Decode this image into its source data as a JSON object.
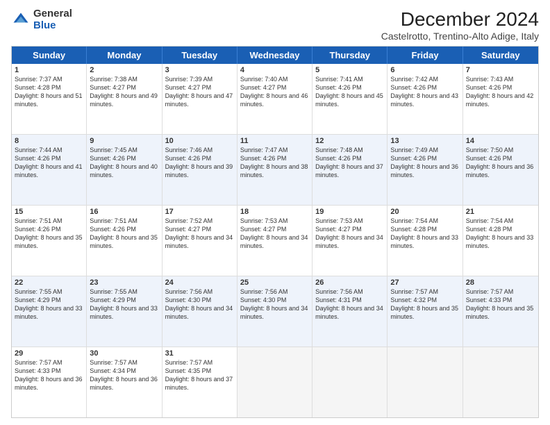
{
  "header": {
    "logo_line1": "General",
    "logo_line2": "Blue",
    "title": "December 2024",
    "subtitle": "Castelrotto, Trentino-Alto Adige, Italy"
  },
  "days_of_week": [
    "Sunday",
    "Monday",
    "Tuesday",
    "Wednesday",
    "Thursday",
    "Friday",
    "Saturday"
  ],
  "weeks": [
    {
      "alt": false,
      "cells": [
        {
          "day": 1,
          "sunrise": "7:37 AM",
          "sunset": "4:28 PM",
          "daylight": "8 hours and 51 minutes."
        },
        {
          "day": 2,
          "sunrise": "7:38 AM",
          "sunset": "4:27 PM",
          "daylight": "8 hours and 49 minutes."
        },
        {
          "day": 3,
          "sunrise": "7:39 AM",
          "sunset": "4:27 PM",
          "daylight": "8 hours and 47 minutes."
        },
        {
          "day": 4,
          "sunrise": "7:40 AM",
          "sunset": "4:27 PM",
          "daylight": "8 hours and 46 minutes."
        },
        {
          "day": 5,
          "sunrise": "7:41 AM",
          "sunset": "4:26 PM",
          "daylight": "8 hours and 45 minutes."
        },
        {
          "day": 6,
          "sunrise": "7:42 AM",
          "sunset": "4:26 PM",
          "daylight": "8 hours and 43 minutes."
        },
        {
          "day": 7,
          "sunrise": "7:43 AM",
          "sunset": "4:26 PM",
          "daylight": "8 hours and 42 minutes."
        }
      ]
    },
    {
      "alt": true,
      "cells": [
        {
          "day": 8,
          "sunrise": "7:44 AM",
          "sunset": "4:26 PM",
          "daylight": "8 hours and 41 minutes."
        },
        {
          "day": 9,
          "sunrise": "7:45 AM",
          "sunset": "4:26 PM",
          "daylight": "8 hours and 40 minutes."
        },
        {
          "day": 10,
          "sunrise": "7:46 AM",
          "sunset": "4:26 PM",
          "daylight": "8 hours and 39 minutes."
        },
        {
          "day": 11,
          "sunrise": "7:47 AM",
          "sunset": "4:26 PM",
          "daylight": "8 hours and 38 minutes."
        },
        {
          "day": 12,
          "sunrise": "7:48 AM",
          "sunset": "4:26 PM",
          "daylight": "8 hours and 37 minutes."
        },
        {
          "day": 13,
          "sunrise": "7:49 AM",
          "sunset": "4:26 PM",
          "daylight": "8 hours and 36 minutes."
        },
        {
          "day": 14,
          "sunrise": "7:50 AM",
          "sunset": "4:26 PM",
          "daylight": "8 hours and 36 minutes."
        }
      ]
    },
    {
      "alt": false,
      "cells": [
        {
          "day": 15,
          "sunrise": "7:51 AM",
          "sunset": "4:26 PM",
          "daylight": "8 hours and 35 minutes."
        },
        {
          "day": 16,
          "sunrise": "7:51 AM",
          "sunset": "4:26 PM",
          "daylight": "8 hours and 35 minutes."
        },
        {
          "day": 17,
          "sunrise": "7:52 AM",
          "sunset": "4:27 PM",
          "daylight": "8 hours and 34 minutes."
        },
        {
          "day": 18,
          "sunrise": "7:53 AM",
          "sunset": "4:27 PM",
          "daylight": "8 hours and 34 minutes."
        },
        {
          "day": 19,
          "sunrise": "7:53 AM",
          "sunset": "4:27 PM",
          "daylight": "8 hours and 34 minutes."
        },
        {
          "day": 20,
          "sunrise": "7:54 AM",
          "sunset": "4:28 PM",
          "daylight": "8 hours and 33 minutes."
        },
        {
          "day": 21,
          "sunrise": "7:54 AM",
          "sunset": "4:28 PM",
          "daylight": "8 hours and 33 minutes."
        }
      ]
    },
    {
      "alt": true,
      "cells": [
        {
          "day": 22,
          "sunrise": "7:55 AM",
          "sunset": "4:29 PM",
          "daylight": "8 hours and 33 minutes."
        },
        {
          "day": 23,
          "sunrise": "7:55 AM",
          "sunset": "4:29 PM",
          "daylight": "8 hours and 33 minutes."
        },
        {
          "day": 24,
          "sunrise": "7:56 AM",
          "sunset": "4:30 PM",
          "daylight": "8 hours and 34 minutes."
        },
        {
          "day": 25,
          "sunrise": "7:56 AM",
          "sunset": "4:30 PM",
          "daylight": "8 hours and 34 minutes."
        },
        {
          "day": 26,
          "sunrise": "7:56 AM",
          "sunset": "4:31 PM",
          "daylight": "8 hours and 34 minutes."
        },
        {
          "day": 27,
          "sunrise": "7:57 AM",
          "sunset": "4:32 PM",
          "daylight": "8 hours and 35 minutes."
        },
        {
          "day": 28,
          "sunrise": "7:57 AM",
          "sunset": "4:33 PM",
          "daylight": "8 hours and 35 minutes."
        }
      ]
    },
    {
      "alt": false,
      "cells": [
        {
          "day": 29,
          "sunrise": "7:57 AM",
          "sunset": "4:33 PM",
          "daylight": "8 hours and 36 minutes."
        },
        {
          "day": 30,
          "sunrise": "7:57 AM",
          "sunset": "4:34 PM",
          "daylight": "8 hours and 36 minutes."
        },
        {
          "day": 31,
          "sunrise": "7:57 AM",
          "sunset": "4:35 PM",
          "daylight": "8 hours and 37 minutes."
        },
        null,
        null,
        null,
        null
      ]
    }
  ]
}
